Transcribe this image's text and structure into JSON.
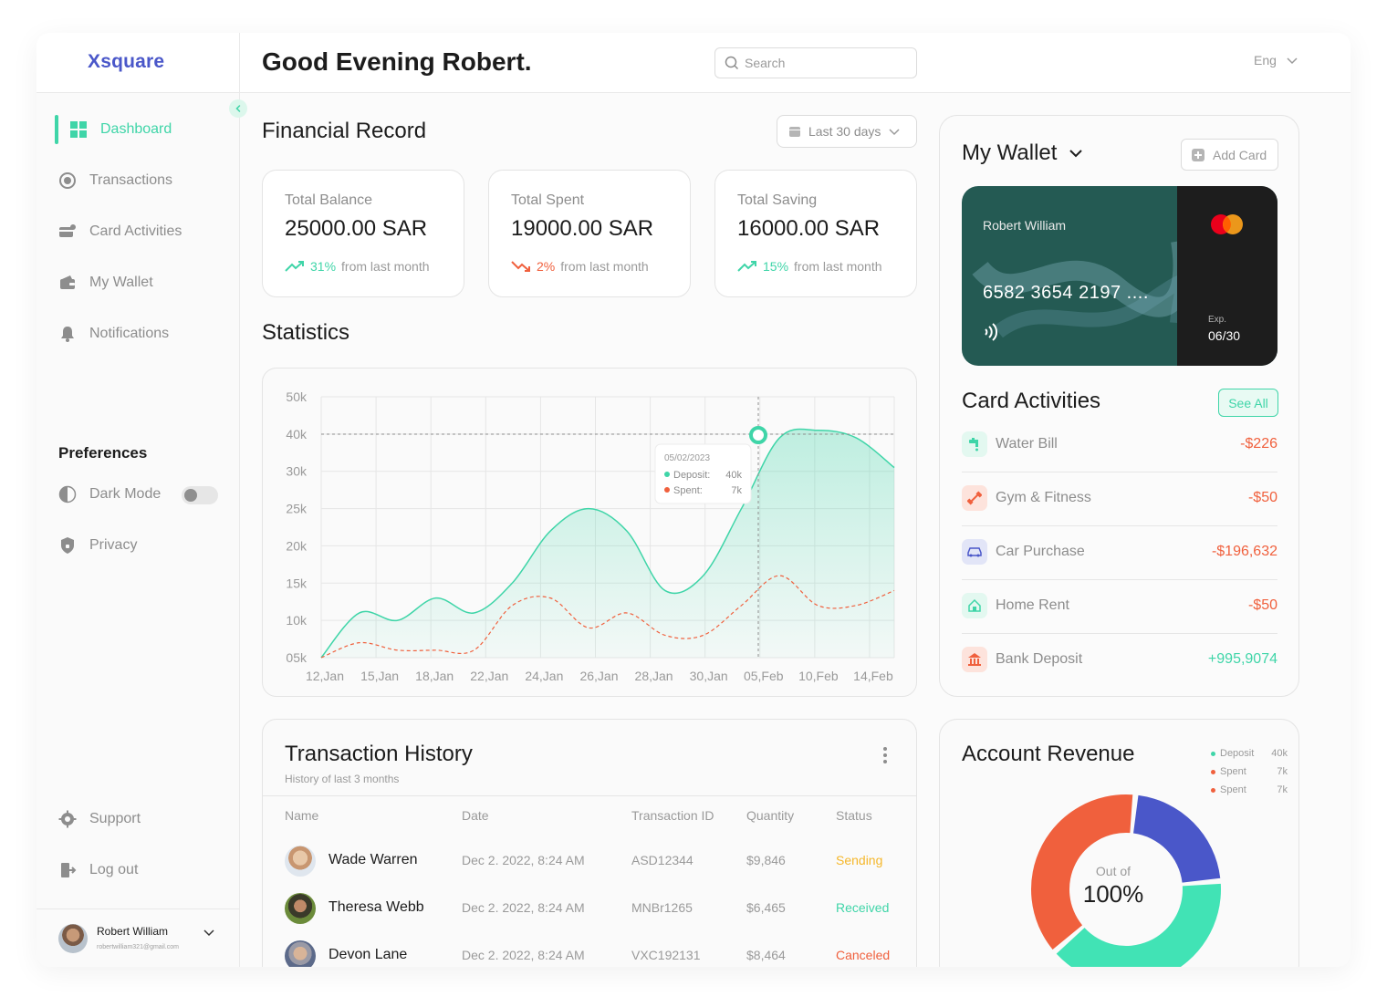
{
  "brand": "Xsquare",
  "greeting": "Good Evening Robert.",
  "search": {
    "placeholder": "Search"
  },
  "language": "Eng",
  "nav": {
    "items": [
      {
        "label": "Dashboard"
      },
      {
        "label": "Transactions"
      },
      {
        "label": "Card Activities"
      },
      {
        "label": "My Wallet"
      },
      {
        "label": "Notifications"
      }
    ],
    "preferences_title": "Preferences",
    "dark_mode": "Dark Mode",
    "privacy": "Privacy",
    "support": "Support",
    "logout": "Log out"
  },
  "user": {
    "name": "Robert William",
    "email": "robertwilliam321@gmail.com"
  },
  "financial": {
    "title": "Financial Record",
    "range": "Last 30 days",
    "cards": [
      {
        "label": "Total Balance",
        "value": "25000.00 SAR",
        "change": "31%",
        "suffix": "from last month",
        "trend": "up"
      },
      {
        "label": "Total Spent",
        "value": "19000.00 SAR",
        "change": "2%",
        "suffix": "from last month",
        "trend": "down"
      },
      {
        "label": "Total Saving",
        "value": "16000.00 SAR",
        "change": "15%",
        "suffix": "from last month",
        "trend": "up"
      }
    ]
  },
  "statistics": {
    "title": "Statistics",
    "tooltip": {
      "date": "05/02/2023",
      "deposit_label": "Deposit:",
      "deposit_value": "40k",
      "spent_label": "Spent:",
      "spent_value": "7k"
    }
  },
  "chart_data": {
    "type": "area",
    "y_ticks": [
      "50k",
      "40k",
      "30k",
      "25k",
      "20k",
      "15k",
      "10k",
      "05k"
    ],
    "x_ticks": [
      "12,Jan",
      "15,Jan",
      "18,Jan",
      "22,Jan",
      "24,Jan",
      "26,Jan",
      "28,Jan",
      "30,Jan",
      "05,Feb",
      "10,Feb",
      "14,Feb"
    ],
    "grid": true,
    "series": [
      {
        "name": "Deposit",
        "color": "#3fd5a8",
        "style": "solid-area",
        "values": [
          5,
          11,
          10,
          13,
          11,
          15,
          22,
          25,
          22,
          14,
          16,
          25,
          39,
          41,
          39,
          31
        ]
      },
      {
        "name": "Spent",
        "color": "#f0603d",
        "style": "dashed",
        "values": [
          5,
          7,
          6,
          6,
          6,
          12,
          13,
          9,
          11,
          8,
          8,
          12,
          16,
          12,
          12,
          14
        ]
      }
    ],
    "highlight": {
      "x": "05,Feb",
      "deposit": "40k",
      "spent": "7k"
    }
  },
  "wallet": {
    "title": "My Wallet",
    "add_card": "Add Card",
    "card": {
      "holder": "Robert William",
      "number": "6582 3654 2197 ....",
      "exp_label": "Exp.",
      "exp": "06/30"
    }
  },
  "card_activities": {
    "title": "Card Activities",
    "see_all": "See All",
    "items": [
      {
        "name": "Water Bill",
        "amount": "-$226",
        "color": "#f0603d",
        "icon": "water-tap-icon",
        "bg": "#e3f8f0",
        "fg": "#3fd5a8"
      },
      {
        "name": "Gym & Fitness",
        "amount": "-$50",
        "color": "#f0603d",
        "icon": "dumbbell-icon",
        "bg": "#fde3dc",
        "fg": "#f0603d"
      },
      {
        "name": "Car Purchase",
        "amount": "-$196,632",
        "color": "#f0603d",
        "icon": "car-icon",
        "bg": "#e2e5f7",
        "fg": "#4a57c9"
      },
      {
        "name": "Home Rent",
        "amount": "-$50",
        "color": "#f0603d",
        "icon": "home-icon",
        "bg": "#e3f8f0",
        "fg": "#3fd5a8"
      },
      {
        "name": "Bank Deposit",
        "amount": "+995,9074",
        "color": "#3fd5a8",
        "icon": "bank-icon",
        "bg": "#fde3dc",
        "fg": "#f0603d"
      }
    ]
  },
  "transactions": {
    "title": "Transaction History",
    "subtitle": "History of last 3 months",
    "columns": [
      "Name",
      "Date",
      "Transaction ID",
      "Quantity",
      "Status"
    ],
    "rows": [
      {
        "name": "Wade Warren",
        "date": "Dec 2. 2022, 8:24 AM",
        "id": "ASD12344",
        "quantity": "$9,846",
        "status": "Sending",
        "status_color": "#f5b72a"
      },
      {
        "name": "Theresa Webb",
        "date": "Dec 2. 2022, 8:24 AM",
        "id": "MNBr1265",
        "quantity": "$6,465",
        "status": "Received",
        "status_color": "#3fd5a8"
      },
      {
        "name": "Devon Lane",
        "date": "Dec 2. 2022, 8:24 AM",
        "id": "VXC192131",
        "quantity": "$8,464",
        "status": "Canceled",
        "status_color": "#f0603d"
      }
    ]
  },
  "revenue": {
    "title": "Account Revenue",
    "legend": [
      {
        "name": "Deposit",
        "value": "40k",
        "color": "#3fd5a8"
      },
      {
        "name": "Spent",
        "value": "7k",
        "color": "#f0603d"
      },
      {
        "name": "Spent",
        "value": "7k",
        "color": "#f0603d"
      }
    ],
    "center_label": "Out of",
    "center_value": "100%",
    "segments": [
      {
        "name": "blue",
        "fraction": 0.22,
        "color": "#4a57c9"
      },
      {
        "name": "green",
        "fraction": 0.4,
        "color": "#41e3b5"
      },
      {
        "name": "orange",
        "fraction": 0.38,
        "color": "#f0603d"
      }
    ]
  }
}
